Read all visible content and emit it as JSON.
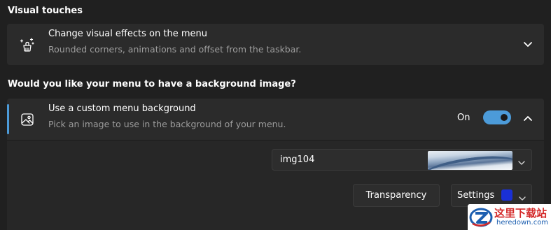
{
  "visual_touches": {
    "heading": "Visual touches",
    "card": {
      "title": "Change visual effects on the menu",
      "description": "Rounded corners, animations and offset from the taskbar.",
      "icon": "sparkle-brush-icon",
      "expand_icon": "chevron-down-icon"
    }
  },
  "background_image": {
    "heading": "Would you like your menu to have a background image?",
    "card": {
      "title": "Use a custom menu background",
      "description": "Pick an image to use in the background of your menu.",
      "icon": "image-icon",
      "toggle_label": "On",
      "toggle_on": true,
      "collapse_icon": "chevron-up-icon"
    },
    "image_select": {
      "value": "img104",
      "dropdown_icon": "chevron-down-icon"
    },
    "transparency_button": "Transparency",
    "settings_select": {
      "label": "Settings",
      "swatch_color": "#1a30d6",
      "dropdown_icon": "chevron-down-icon"
    }
  },
  "colors": {
    "accent": "#4c9bd9",
    "background": "#202020",
    "card": "#2b2b2b"
  },
  "watermark": {
    "text": "这里下载站",
    "url": "heredown.com"
  }
}
